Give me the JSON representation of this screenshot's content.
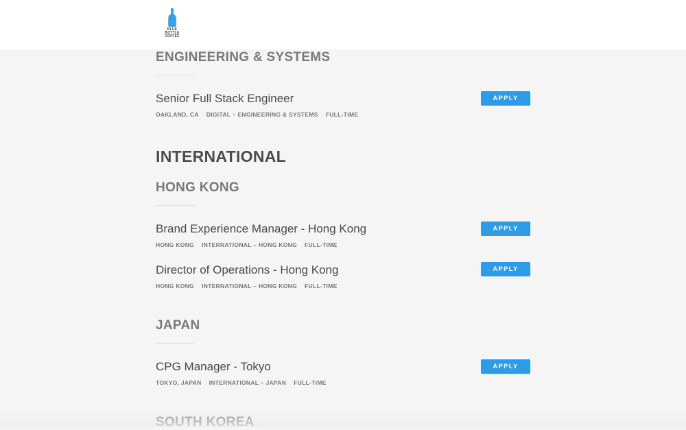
{
  "header": {
    "logo_text_line1": "BLUE BOTTLE",
    "logo_text_line2": "COFFEE"
  },
  "sections": {
    "engineering": {
      "heading": "ENGINEERING & SYSTEMS",
      "jobs": [
        {
          "title": "Senior Full Stack Engineer",
          "location": "OAKLAND, CA",
          "department": "DIGITAL – ENGINEERING & SYSTEMS",
          "type": "FULL-TIME",
          "apply_label": "APPLY"
        }
      ]
    },
    "international": {
      "heading": "INTERNATIONAL"
    },
    "hong_kong": {
      "heading": "HONG KONG",
      "jobs": [
        {
          "title": "Brand Experience Manager - Hong Kong",
          "location": "HONG KONG",
          "department": "INTERNATIONAL – HONG KONG",
          "type": "FULL-TIME",
          "apply_label": "APPLY"
        },
        {
          "title": "Director of Operations - Hong Kong",
          "location": "HONG KONG",
          "department": "INTERNATIONAL – HONG KONG",
          "type": "FULL-TIME",
          "apply_label": "APPLY"
        }
      ]
    },
    "japan": {
      "heading": "JAPAN",
      "jobs": [
        {
          "title": "CPG Manager - Tokyo",
          "location": "TOKYO, JAPAN",
          "department": "INTERNATIONAL – JAPAN",
          "type": "FULL-TIME",
          "apply_label": "APPLY"
        }
      ]
    },
    "south_korea": {
      "heading": "SOUTH KOREA"
    }
  },
  "colors": {
    "accent": "#2f9ae6",
    "logo_blue": "#3a9ee4"
  }
}
